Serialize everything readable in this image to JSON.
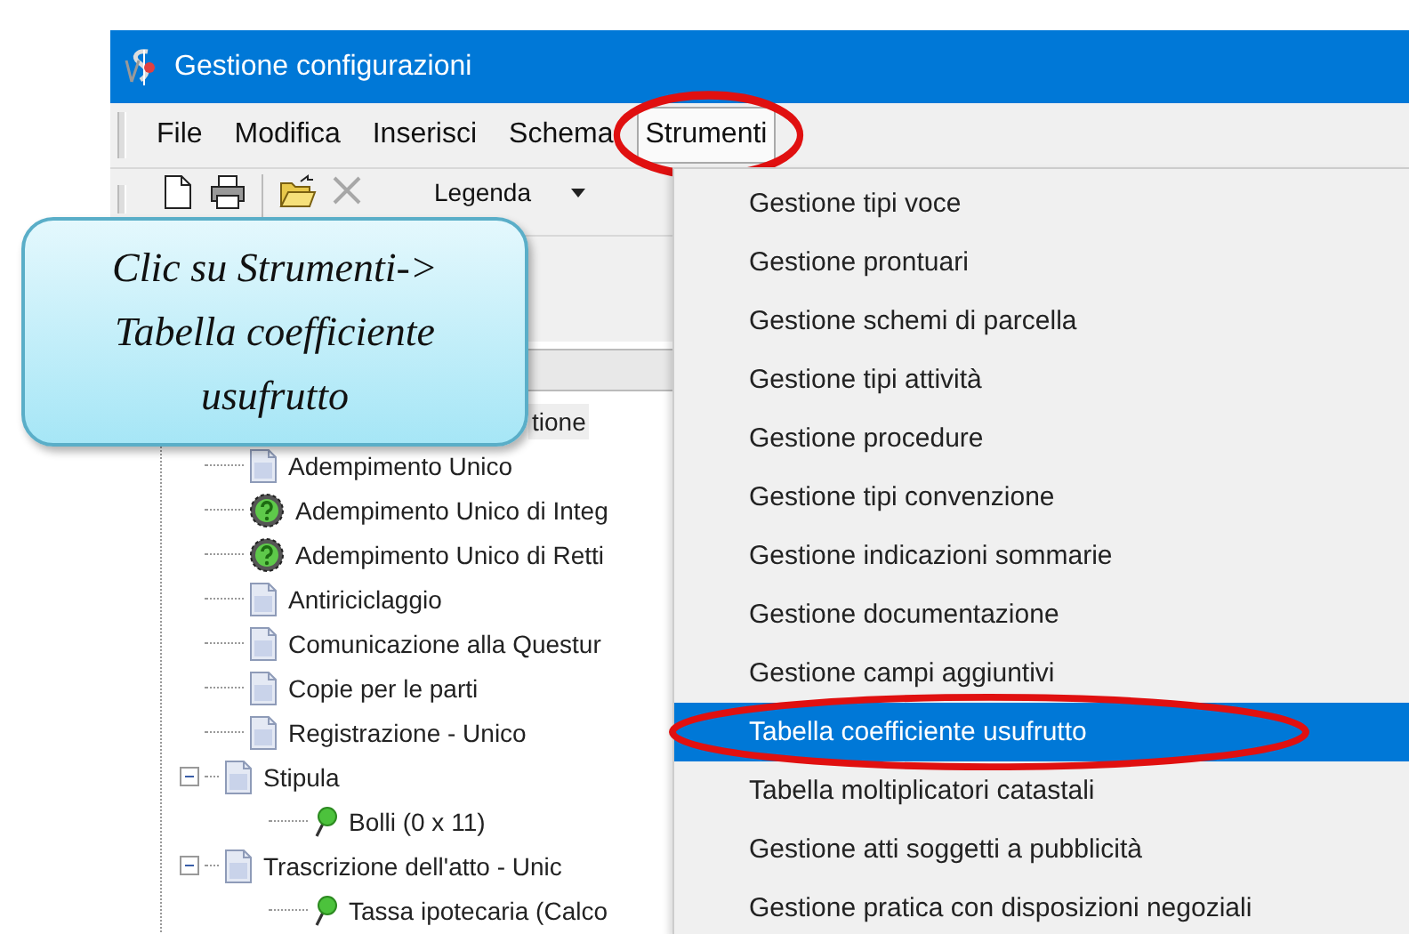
{
  "window": {
    "title": "Gestione configurazioni"
  },
  "menubar": [
    {
      "label": "File",
      "selected": false
    },
    {
      "label": "Modifica",
      "selected": false
    },
    {
      "label": "Inserisci",
      "selected": false
    },
    {
      "label": "Schema",
      "selected": false
    },
    {
      "label": "Strumenti",
      "selected": true
    }
  ],
  "toolbar": {
    "buttons": [
      {
        "kind": "new",
        "disabled": false
      },
      {
        "kind": "print",
        "disabled": false
      },
      {
        "kind": "open",
        "disabled": false
      },
      {
        "kind": "delete",
        "disabled": true
      }
    ],
    "dropdown": {
      "label": "Legenda"
    }
  },
  "tree": {
    "partial_row": "tione",
    "items": [
      {
        "label": "Adempimento Unico",
        "kind": "document",
        "expanded": false
      },
      {
        "label": "Adempimento Unico di Integ",
        "kind": "question",
        "expanded": false
      },
      {
        "label": "Adempimento Unico di Retti",
        "kind": "question",
        "expanded": false
      },
      {
        "label": "Antiriciclaggio",
        "kind": "document",
        "expanded": false
      },
      {
        "label": "Comunicazione alla Questur",
        "kind": "document",
        "expanded": false
      },
      {
        "label": "Copie per le parti",
        "kind": "document",
        "expanded": false
      },
      {
        "label": "Registrazione - Unico",
        "kind": "document",
        "expanded": false
      },
      {
        "label": "Stipula",
        "kind": "document",
        "expanded": true,
        "children": [
          {
            "label": "Bolli (0 x 11)",
            "kind": "pin",
            "expanded": false
          }
        ]
      },
      {
        "label": "Trascrizione dell'atto - Unic",
        "kind": "document",
        "expanded": true,
        "children": [
          {
            "label": "Tassa ipotecaria (Calco",
            "kind": "pin",
            "expanded": false
          }
        ]
      }
    ]
  },
  "menu": [
    {
      "label": "Gestione tipi voce",
      "selected": false
    },
    {
      "label": "Gestione prontuari",
      "selected": false
    },
    {
      "label": "Gestione schemi di parcella",
      "selected": false
    },
    {
      "label": "Gestione tipi attività",
      "selected": false
    },
    {
      "label": "Gestione procedure",
      "selected": false
    },
    {
      "label": "Gestione tipi convenzione",
      "selected": false
    },
    {
      "label": "Gestione indicazioni sommarie",
      "selected": false
    },
    {
      "label": "Gestione documentazione",
      "selected": false
    },
    {
      "label": "Gestione campi aggiuntivi",
      "selected": false
    },
    {
      "label": "Tabella coefficiente usufrutto",
      "selected": true
    },
    {
      "label": "Tabella moltiplicatori catastali",
      "selected": false
    },
    {
      "label": "Gestione atti soggetti a pubblicità",
      "selected": false
    },
    {
      "label": "Gestione pratica con disposizioni negoziali",
      "selected": false
    }
  ],
  "callout": {
    "lines": [
      "Clic su Strumenti->",
      "Tabella coefficiente",
      "usufrutto"
    ]
  }
}
